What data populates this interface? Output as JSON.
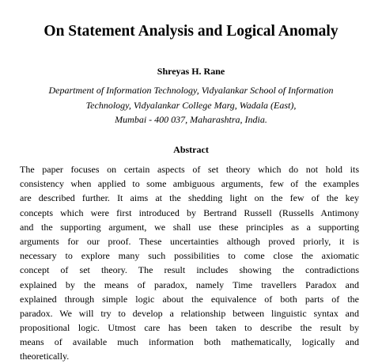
{
  "title": "On Statement Analysis and Logical Anomaly",
  "author": "Shreyas H. Rane",
  "affiliation": [
    "Department of Information Technology, Vidyalankar School of Information",
    "Technology, Vidyalankar College Marg, Wadala (East),",
    "Mumbai - 400 037, Maharashtra, India."
  ],
  "abstract": {
    "heading": "Abstract",
    "lines": [
      "The paper focuses on certain aspects of set theory which do not hold its",
      "consistency when applied to some ambiguous arguments, few of the examples",
      "are described further. It aims at the shedding light on the few of the key",
      "concepts which were first introduced by Bertrand Russell (Russells Antimony",
      "and the supporting argument, we shall use these principles as a supporting",
      "arguments for our proof. These uncertainties although proved priorly, it is",
      "necessary to explore many such possibilities to come close the axiomatic",
      "concept of set theory. The result includes showing the contradictions",
      "explained by the means of paradox, namely Time travellers Paradox and",
      "explained through simple logic about the equivalence of both parts of the",
      "paradox. We will try to develop a relationship between linguistic syntax and",
      "propositional logic. Utmost care has been taken to describe the result by",
      "means of available much information both mathematically, logically and",
      "theoretically."
    ]
  }
}
